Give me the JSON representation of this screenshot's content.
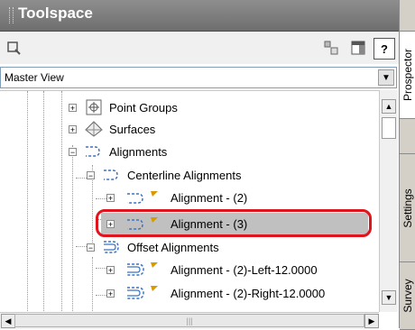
{
  "window": {
    "title": "Toolspace"
  },
  "tabs": [
    {
      "label": "Prospector"
    },
    {
      "label": "Settings"
    },
    {
      "label": "Survey"
    }
  ],
  "toolbar": {
    "view_selector": "Master View",
    "help_label": "?"
  },
  "tree": {
    "point_groups": "Point Groups",
    "surfaces": "Surfaces",
    "alignments": "Alignments",
    "centerline_alignments": "Centerline Alignments",
    "alignment_2": "Alignment - (2)",
    "alignment_3": "Alignment - (3)",
    "offset_alignments": "Offset Alignments",
    "alignment_2_left": "Alignment - (2)-Left-12.0000",
    "alignment_2_right": "Alignment - (2)-Right-12.0000"
  },
  "colors": {
    "highlight_outline": "#e0141c",
    "selected_row": "#c0c0c0",
    "titlebar": "#7a7a7a"
  },
  "icons": [
    "magnifier-icon",
    "item-view-icon",
    "panel-toggle-icon",
    "help-icon",
    "point-groups-icon",
    "surfaces-icon",
    "alignment-icon",
    "offset-alignment-icon"
  ]
}
